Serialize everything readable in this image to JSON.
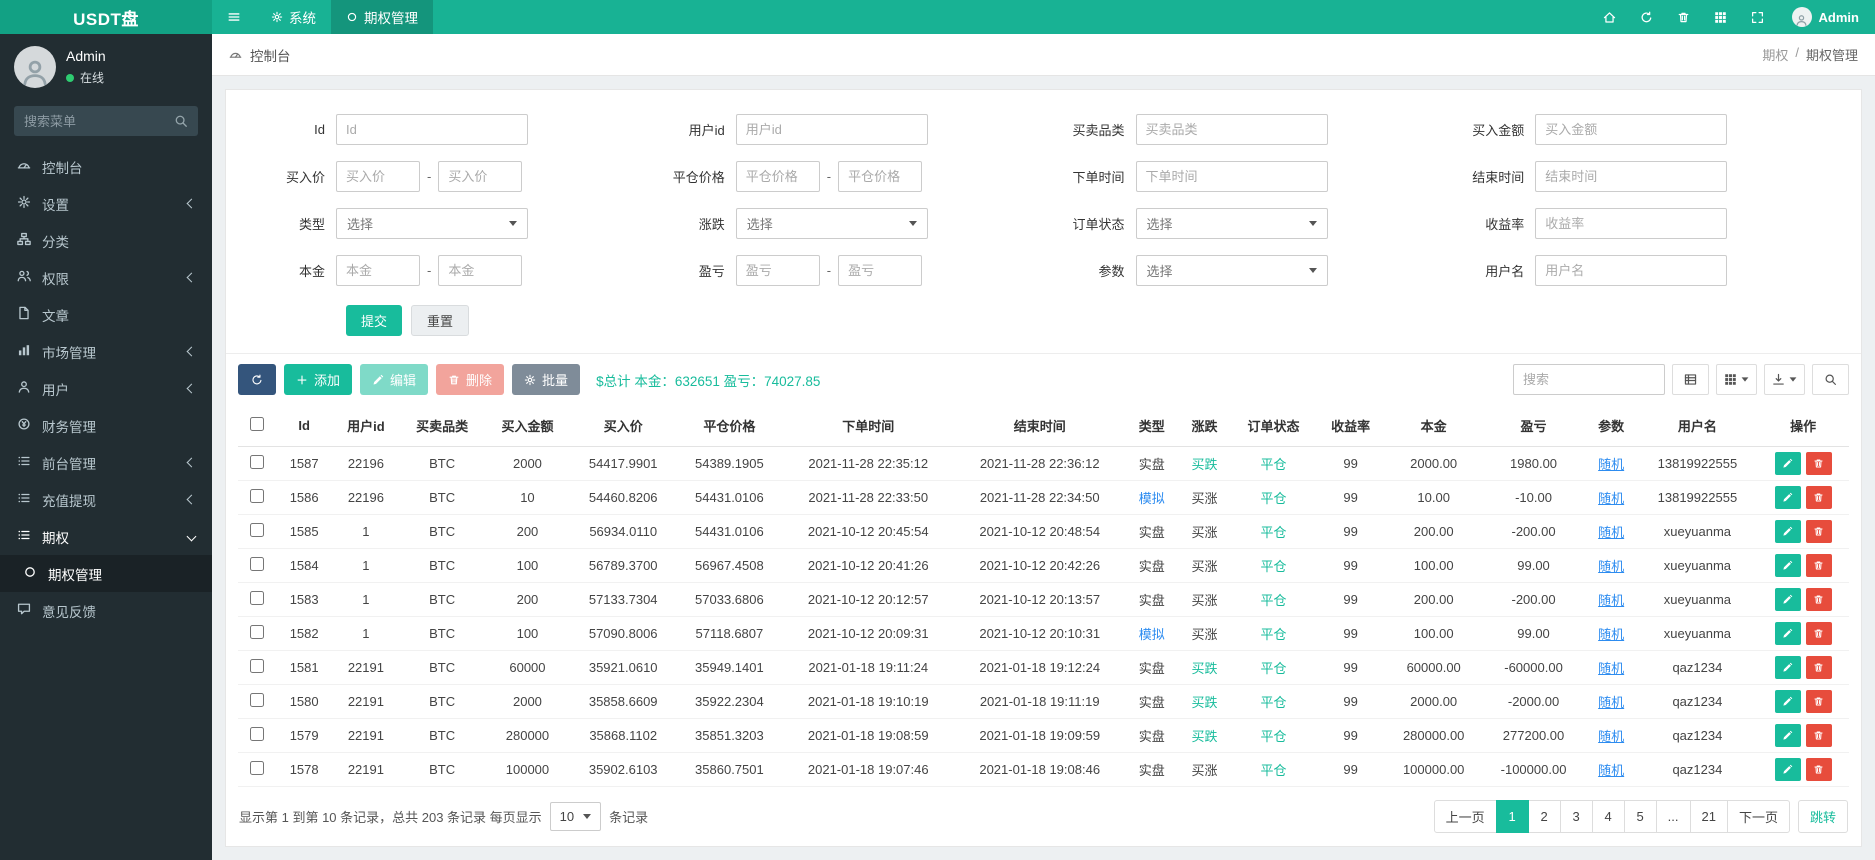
{
  "navbar": {
    "logo": "USDT盘",
    "menu": [
      {
        "key": "system",
        "label": "系统",
        "icon": "gear",
        "active": false
      },
      {
        "key": "option-manage",
        "label": "期权管理",
        "icon": "circle",
        "active": true
      }
    ],
    "right_icons": [
      "home",
      "refresh",
      "trash",
      "th",
      "expand"
    ],
    "user": {
      "name": "Admin"
    }
  },
  "sidebar": {
    "user": {
      "name": "Admin",
      "status": "在线"
    },
    "search_placeholder": "搜索菜单",
    "items": [
      {
        "key": "dashboard",
        "label": "控制台",
        "icon": "gauge"
      },
      {
        "key": "settings",
        "label": "设置",
        "icon": "gear",
        "chevron": "left"
      },
      {
        "key": "category",
        "label": "分类",
        "icon": "sitemap"
      },
      {
        "key": "permission",
        "label": "权限",
        "icon": "users",
        "chevron": "left"
      },
      {
        "key": "article",
        "label": "文章",
        "icon": "file"
      },
      {
        "key": "market",
        "label": "市场管理",
        "icon": "chart",
        "chevron": "left"
      },
      {
        "key": "user",
        "label": "用户",
        "icon": "user",
        "chevron": "left"
      },
      {
        "key": "finance",
        "label": "财务管理",
        "icon": "money"
      },
      {
        "key": "frontend",
        "label": "前台管理",
        "icon": "list",
        "chevron": "left"
      },
      {
        "key": "recharge",
        "label": "充值提现",
        "icon": "list",
        "chevron": "left"
      },
      {
        "key": "option",
        "label": "期权",
        "icon": "list",
        "chevron": "down",
        "open": true
      },
      {
        "key": "option-manage",
        "label": "期权管理",
        "icon": "circle",
        "sub": true,
        "active": true
      },
      {
        "key": "feedback",
        "label": "意见反馈",
        "icon": "comment"
      }
    ]
  },
  "breadcrumb": {
    "left": "控制台",
    "path": [
      "期权",
      "期权管理"
    ],
    "separator": "/"
  },
  "filter": {
    "rows": [
      [
        {
          "key": "id",
          "label": "Id",
          "type": "input",
          "placeholder": "Id"
        },
        {
          "key": "user_id",
          "label": "用户id",
          "type": "input",
          "placeholder": "用户id"
        },
        {
          "key": "category",
          "label": "买卖品类",
          "type": "input",
          "placeholder": "买卖品类"
        },
        {
          "key": "amount",
          "label": "买入金额",
          "type": "input",
          "placeholder": "买入金额"
        }
      ],
      [
        {
          "key": "buy_price",
          "label": "买入价",
          "type": "range",
          "placeholder": "买入价"
        },
        {
          "key": "close_price",
          "label": "平仓价格",
          "type": "range",
          "placeholder": "平仓价格"
        },
        {
          "key": "order_time",
          "label": "下单时间",
          "type": "input",
          "placeholder": "下单时间"
        },
        {
          "key": "end_time",
          "label": "结束时间",
          "type": "input",
          "placeholder": "结束时间"
        }
      ],
      [
        {
          "key": "type",
          "label": "类型",
          "type": "select",
          "placeholder": "选择"
        },
        {
          "key": "updown",
          "label": "涨跌",
          "type": "select",
          "placeholder": "选择"
        },
        {
          "key": "order_status",
          "label": "订单状态",
          "type": "select",
          "placeholder": "选择"
        },
        {
          "key": "rate",
          "label": "收益率",
          "type": "input",
          "placeholder": "收益率"
        }
      ],
      [
        {
          "key": "principal",
          "label": "本金",
          "type": "range",
          "placeholder": "本金"
        },
        {
          "key": "profit",
          "label": "盈亏",
          "type": "range",
          "placeholder": "盈亏"
        },
        {
          "key": "param",
          "label": "参数",
          "type": "select",
          "placeholder": "选择"
        },
        {
          "key": "username",
          "label": "用户名",
          "type": "input",
          "placeholder": "用户名"
        }
      ]
    ],
    "submit_label": "提交",
    "reset_label": "重置"
  },
  "toolbar": {
    "buttons": [
      {
        "key": "refresh",
        "icon": "refresh",
        "label": ""
      },
      {
        "key": "add",
        "icon": "plus",
        "label": "添加"
      },
      {
        "key": "edit",
        "icon": "pencil",
        "label": "编辑"
      },
      {
        "key": "delete",
        "icon": "trash",
        "label": "删除"
      },
      {
        "key": "batch",
        "icon": "gear",
        "label": "批量"
      }
    ],
    "total_text": "$总计 本金：632651 盈亏：74027.85",
    "search_placeholder": "搜索",
    "view_buttons": [
      {
        "key": "view-toggle",
        "icon": "tablelist",
        "caret": false
      },
      {
        "key": "columns",
        "icon": "th",
        "caret": true
      },
      {
        "key": "export",
        "icon": "export",
        "caret": true
      },
      {
        "key": "search-toggle",
        "icon": "search",
        "caret": false
      }
    ]
  },
  "table": {
    "columns": [
      {
        "key": "id",
        "label": "Id"
      },
      {
        "key": "user_id",
        "label": "用户id"
      },
      {
        "key": "category",
        "label": "买卖品类"
      },
      {
        "key": "amount",
        "label": "买入金额"
      },
      {
        "key": "buy_price",
        "label": "买入价"
      },
      {
        "key": "close_price",
        "label": "平仓价格"
      },
      {
        "key": "order_time",
        "label": "下单时间"
      },
      {
        "key": "end_time",
        "label": "结束时间"
      },
      {
        "key": "type",
        "label": "类型"
      },
      {
        "key": "direction",
        "label": "涨跌"
      },
      {
        "key": "order_status",
        "label": "订单状态"
      },
      {
        "key": "rate",
        "label": "收益率"
      },
      {
        "key": "principal",
        "label": "本金"
      },
      {
        "key": "profit",
        "label": "盈亏"
      },
      {
        "key": "param",
        "label": "参数"
      },
      {
        "key": "username",
        "label": "用户名"
      },
      {
        "key": "actions",
        "label": "操作"
      }
    ],
    "highlight": {
      "type_blue": "模拟",
      "direction_green": "买跌"
    },
    "rows": [
      {
        "id": "1587",
        "user_id": "22196",
        "category": "BTC",
        "amount": "2000",
        "buy_price": "54417.9901",
        "close_price": "54389.1905",
        "order_time": "2021-11-28 22:35:12",
        "end_time": "2021-11-28 22:36:12",
        "type": "实盘",
        "direction": "买跌",
        "order_status": "平仓",
        "rate": "99",
        "principal": "2000.00",
        "profit": "1980.00",
        "param": "随机",
        "username": "13819922555"
      },
      {
        "id": "1586",
        "user_id": "22196",
        "category": "BTC",
        "amount": "10",
        "buy_price": "54460.8206",
        "close_price": "54431.0106",
        "order_time": "2021-11-28 22:33:50",
        "end_time": "2021-11-28 22:34:50",
        "type": "模拟",
        "direction": "买涨",
        "order_status": "平仓",
        "rate": "99",
        "principal": "10.00",
        "profit": "-10.00",
        "param": "随机",
        "username": "13819922555"
      },
      {
        "id": "1585",
        "user_id": "1",
        "category": "BTC",
        "amount": "200",
        "buy_price": "56934.0110",
        "close_price": "54431.0106",
        "order_time": "2021-10-12 20:45:54",
        "end_time": "2021-10-12 20:48:54",
        "type": "实盘",
        "direction": "买涨",
        "order_status": "平仓",
        "rate": "99",
        "principal": "200.00",
        "profit": "-200.00",
        "param": "随机",
        "username": "xueyuanma"
      },
      {
        "id": "1584",
        "user_id": "1",
        "category": "BTC",
        "amount": "100",
        "buy_price": "56789.3700",
        "close_price": "56967.4508",
        "order_time": "2021-10-12 20:41:26",
        "end_time": "2021-10-12 20:42:26",
        "type": "实盘",
        "direction": "买涨",
        "order_status": "平仓",
        "rate": "99",
        "principal": "100.00",
        "profit": "99.00",
        "param": "随机",
        "username": "xueyuanma"
      },
      {
        "id": "1583",
        "user_id": "1",
        "category": "BTC",
        "amount": "200",
        "buy_price": "57133.7304",
        "close_price": "57033.6806",
        "order_time": "2021-10-12 20:12:57",
        "end_time": "2021-10-12 20:13:57",
        "type": "实盘",
        "direction": "买涨",
        "order_status": "平仓",
        "rate": "99",
        "principal": "200.00",
        "profit": "-200.00",
        "param": "随机",
        "username": "xueyuanma"
      },
      {
        "id": "1582",
        "user_id": "1",
        "category": "BTC",
        "amount": "100",
        "buy_price": "57090.8006",
        "close_price": "57118.6807",
        "order_time": "2021-10-12 20:09:31",
        "end_time": "2021-10-12 20:10:31",
        "type": "模拟",
        "direction": "买涨",
        "order_status": "平仓",
        "rate": "99",
        "principal": "100.00",
        "profit": "99.00",
        "param": "随机",
        "username": "xueyuanma"
      },
      {
        "id": "1581",
        "user_id": "22191",
        "category": "BTC",
        "amount": "60000",
        "buy_price": "35921.0610",
        "close_price": "35949.1401",
        "order_time": "2021-01-18 19:11:24",
        "end_time": "2021-01-18 19:12:24",
        "type": "实盘",
        "direction": "买跌",
        "order_status": "平仓",
        "rate": "99",
        "principal": "60000.00",
        "profit": "-60000.00",
        "param": "随机",
        "username": "qaz1234"
      },
      {
        "id": "1580",
        "user_id": "22191",
        "category": "BTC",
        "amount": "2000",
        "buy_price": "35858.6609",
        "close_price": "35922.2304",
        "order_time": "2021-01-18 19:10:19",
        "end_time": "2021-01-18 19:11:19",
        "type": "实盘",
        "direction": "买跌",
        "order_status": "平仓",
        "rate": "99",
        "principal": "2000.00",
        "profit": "-2000.00",
        "param": "随机",
        "username": "qaz1234"
      },
      {
        "id": "1579",
        "user_id": "22191",
        "category": "BTC",
        "amount": "280000",
        "buy_price": "35868.1102",
        "close_price": "35851.3203",
        "order_time": "2021-01-18 19:08:59",
        "end_time": "2021-01-18 19:09:59",
        "type": "实盘",
        "direction": "买跌",
        "order_status": "平仓",
        "rate": "99",
        "principal": "280000.00",
        "profit": "277200.00",
        "param": "随机",
        "username": "qaz1234"
      },
      {
        "id": "1578",
        "user_id": "22191",
        "category": "BTC",
        "amount": "100000",
        "buy_price": "35902.6103",
        "close_price": "35860.7501",
        "order_time": "2021-01-18 19:07:46",
        "end_time": "2021-01-18 19:08:46",
        "type": "实盘",
        "direction": "买涨",
        "order_status": "平仓",
        "rate": "99",
        "principal": "100000.00",
        "profit": "-100000.00",
        "param": "随机",
        "username": "qaz1234"
      }
    ]
  },
  "pagination": {
    "info_prefix": "显示第 1 到第 10 条记录，总共 203 条记录 每页显示",
    "per_page": "10",
    "info_suffix": "条记录",
    "prev": "上一页",
    "pages": [
      "1",
      "2",
      "3",
      "4",
      "5",
      "...",
      "21"
    ],
    "active": "1",
    "next": "下一页",
    "jump": "跳转"
  },
  "colors": {
    "primary": "#18bc9c",
    "navbar": "#18b294",
    "sidebar": "#222d32",
    "danger": "#e74c3c",
    "link_blue": "#2d8cf0"
  }
}
